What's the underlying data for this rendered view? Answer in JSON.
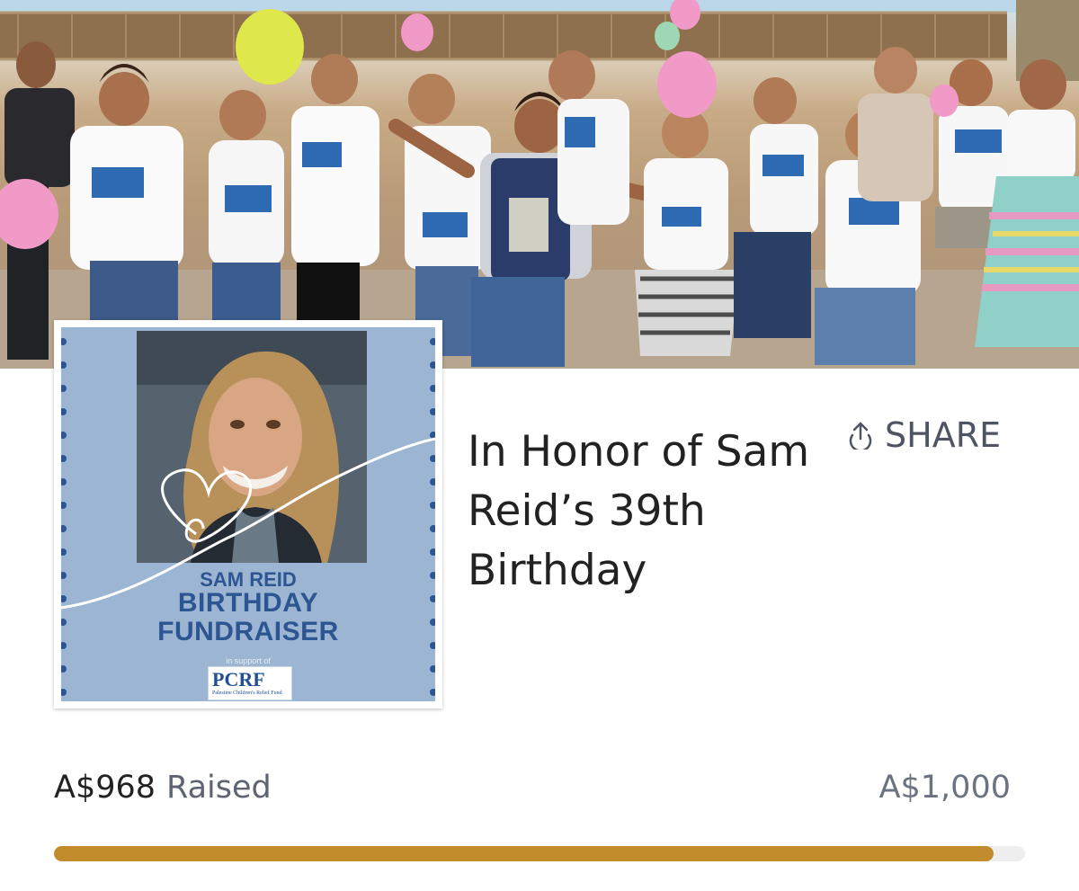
{
  "hero": {
    "banner_text": "PCRF"
  },
  "card": {
    "name": "SAM REID",
    "line1": "BIRTHDAY",
    "line2": "FUNDRAISER",
    "support": "in support of",
    "logo_text": "PCRF",
    "logo_sub": "Palestine Children's Relief Fund"
  },
  "fundraiser": {
    "title": "In Honor of Sam Reid’s 39th Birthday",
    "share_label": "SHARE",
    "share_icon": "share-upload-icon"
  },
  "progress": {
    "raised_amount": "A$968",
    "raised_label": "Raised",
    "goal_amount": "A$1,000",
    "fraction": 0.968,
    "bar_color": "#c28b2c",
    "track_color": "#eeeeee"
  }
}
